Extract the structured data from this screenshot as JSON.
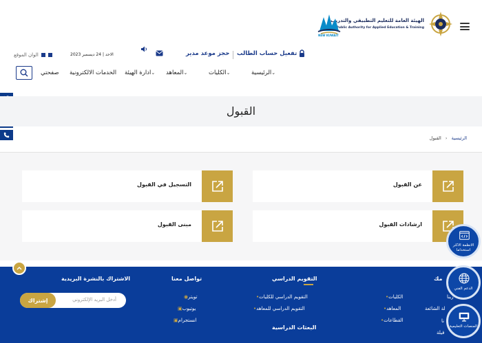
{
  "header": {
    "logo_ar": "الهيئة العامة للتعليم التطبيقي والتدريب",
    "logo_en": "The Public Authority for Applied Education & Training",
    "kuwait_logo_text": "NEW KUWAIT"
  },
  "utility": {
    "activate_account": "تفعيل حساب الطالب",
    "book_appointment": "حجز موعد مدير",
    "date": "الاحد | 24 ديسمبر 2023",
    "site_colors": "الوان الموقع",
    "colors": {
      "gold": "#c9a542",
      "blue": "#0c3a8a"
    }
  },
  "nav": {
    "items": [
      {
        "label": "الرئيسية"
      },
      {
        "label": "الكليات"
      },
      {
        "label": "المعاهد"
      },
      {
        "label": "ادارة الهيئة"
      },
      {
        "label": "الخدمات الالكترونية"
      },
      {
        "label": "صفحتي"
      }
    ]
  },
  "page": {
    "title": "القبول",
    "breadcrumb_home": "الرئيسية",
    "breadcrumb_current": "القبول"
  },
  "cards": [
    {
      "label": "عن القبول"
    },
    {
      "label": "التسجيل في القبول"
    },
    {
      "label": "ارشادات القبول"
    },
    {
      "label": "مبنى القبول"
    }
  ],
  "floating": {
    "most_used": "الانظمة الاكثر استخداما",
    "tech_support": "الدعم الفني",
    "edu_platforms": "المنصات التعليمية"
  },
  "footer": {
    "newsletter_title": "الاشتراك بالنشرة البريدية",
    "newsletter_placeholder": "أدخل البريد الإلكتروني",
    "subscribe": "إشتراك",
    "contact_title": "تواصل معنا",
    "twitter": "تويتر",
    "youtube": "يوتيوب",
    "instagram": "انستجرام",
    "calendar_title": "التقويم الدراسي",
    "calendar_colleges": "التقويم الدراسي للكليات",
    "calendar_institutes": "التقويم الدراسي للمعاهد",
    "missions_title": "البعثات الدراسية",
    "colleges": "الكليات",
    "institutes": "المعاهد",
    "sectors": "القطاعات",
    "partial_1": "مك",
    "partial_2": "زينا",
    "partial_3": "لة الشائعة",
    "partial_4": "نا",
    "partial_5": "فيلة"
  }
}
